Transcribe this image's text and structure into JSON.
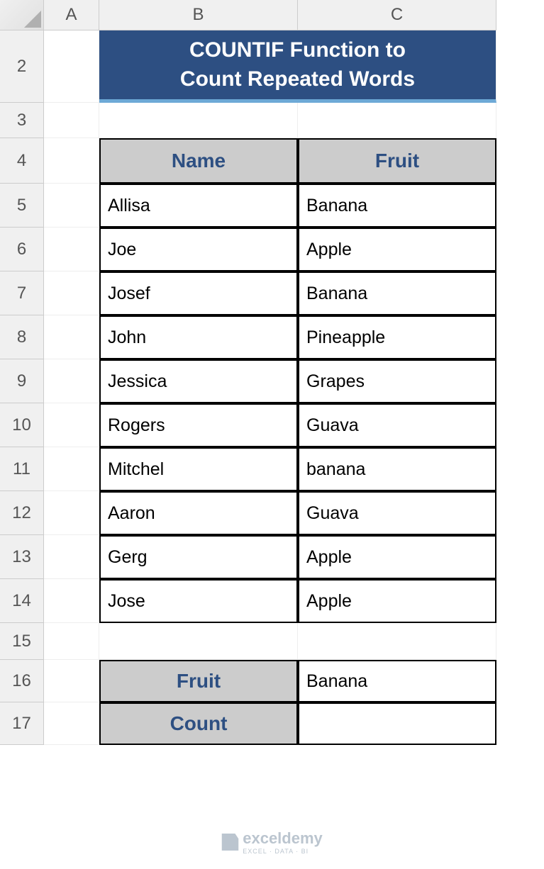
{
  "columns": {
    "A": "A",
    "B": "B",
    "C": "C"
  },
  "rows": {
    "r2": "2",
    "r3": "3",
    "r4": "4",
    "r5": "5",
    "r6": "6",
    "r7": "7",
    "r8": "8",
    "r9": "9",
    "r10": "10",
    "r11": "11",
    "r12": "12",
    "r13": "13",
    "r14": "14",
    "r15": "15",
    "r16": "16",
    "r17": "17"
  },
  "title": {
    "line1": "COUNTIF Function to",
    "line2": "Count Repeated Words"
  },
  "headers": {
    "name": "Name",
    "fruit": "Fruit"
  },
  "data": [
    {
      "name": "Allisa",
      "fruit": "Banana"
    },
    {
      "name": "Joe",
      "fruit": "Apple"
    },
    {
      "name": "Josef",
      "fruit": "Banana"
    },
    {
      "name": "John",
      "fruit": "Pineapple"
    },
    {
      "name": "Jessica",
      "fruit": "Grapes"
    },
    {
      "name": "Rogers",
      "fruit": "Guava"
    },
    {
      "name": "Mitchel",
      "fruit": "banana"
    },
    {
      "name": "Aaron",
      "fruit": "Guava"
    },
    {
      "name": "Gerg",
      "fruit": "Apple"
    },
    {
      "name": "Jose",
      "fruit": "Apple"
    }
  ],
  "summary": {
    "fruit_label": "Fruit",
    "fruit_value": "Banana",
    "count_label": "Count",
    "count_value": ""
  },
  "watermark": {
    "brand": "exceldemy",
    "sub": "EXCEL · DATA · BI"
  }
}
